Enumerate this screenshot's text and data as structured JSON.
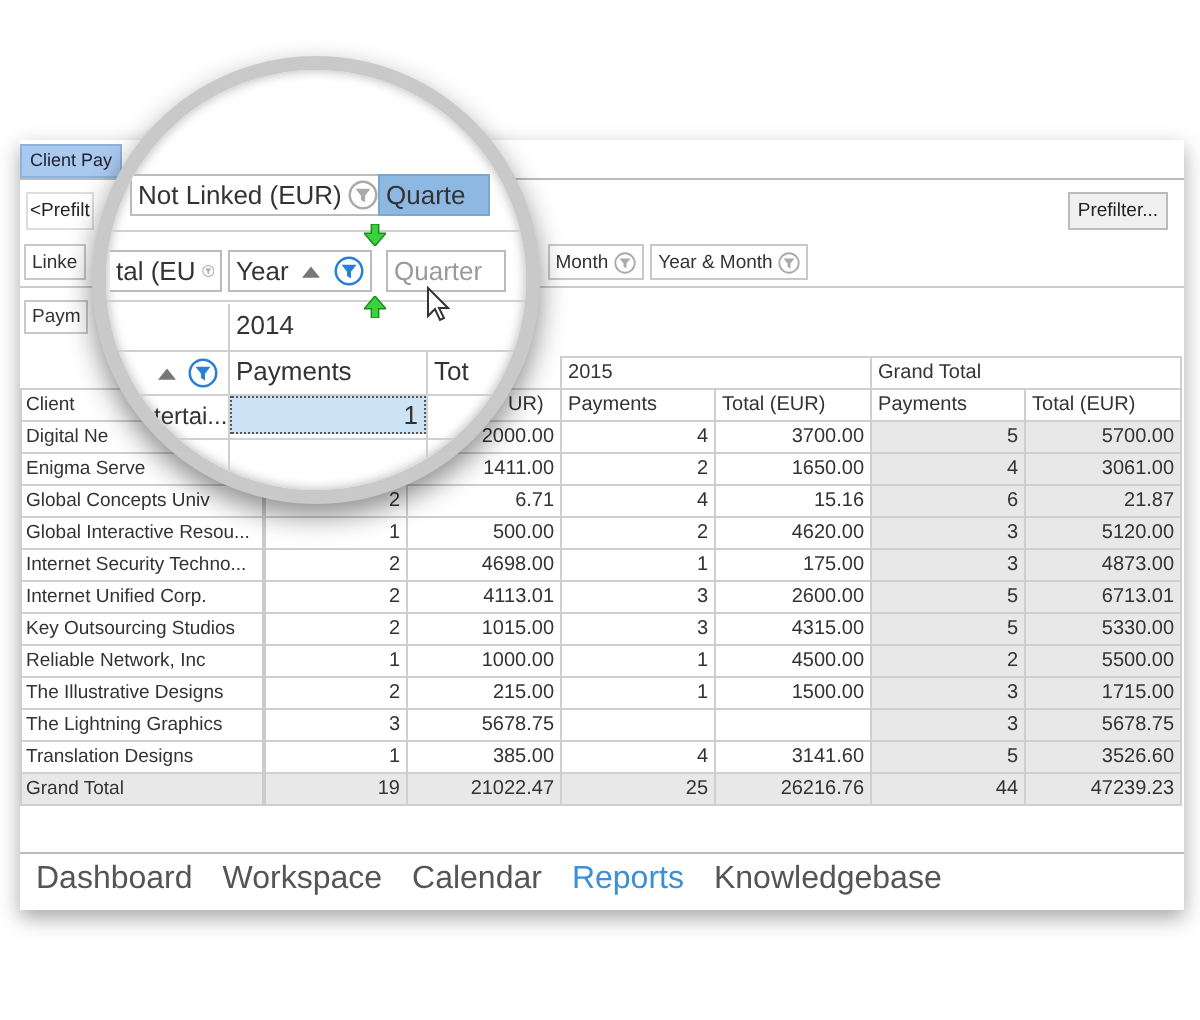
{
  "window_tab": {
    "label": "Client Pay",
    "selected": true
  },
  "toolbar": {
    "prefilter_left": "<Prefilt",
    "prefilter_button": "Prefilter..."
  },
  "column_fields": [
    {
      "label": "Linke"
    },
    {
      "label": "Month",
      "filtered": false
    },
    {
      "label": "Year & Month",
      "filtered": false
    }
  ],
  "data_field": {
    "label": "Paym"
  },
  "magnifier": {
    "data_fields": [
      {
        "label": "Not Linked (EUR)",
        "filtered": false,
        "selected": false
      },
      {
        "label": "Quarte",
        "selected": true
      }
    ],
    "column_fields": [
      {
        "label": "tal (EU",
        "filtered": false,
        "dragged": false
      },
      {
        "label": "Year",
        "filtered": true,
        "sorted": true,
        "dragged": false
      },
      {
        "label": "Quarter",
        "dragged": true
      }
    ],
    "year_header": "2014",
    "client_header_filtered": true,
    "payments_header": "Payments",
    "total_header": "Tot",
    "row_label": "tertai...",
    "selected_cell": "1"
  },
  "table": {
    "year_headers": [
      "2015",
      "Grand Total"
    ],
    "columns": [
      "Client",
      null,
      "UR)",
      "Payments",
      "Total (EUR)",
      "Payments",
      "Total (EUR)"
    ],
    "rows": [
      {
        "kind": "data",
        "cells": [
          "Digital Ne",
          null,
          "2000.00",
          "4",
          "3700.00",
          "5",
          "5700.00"
        ]
      },
      {
        "kind": "data",
        "cells": [
          "Enigma Serve",
          null,
          "1411.00",
          "2",
          "1650.00",
          "4",
          "3061.00"
        ]
      },
      {
        "kind": "data",
        "cells": [
          "Global Concepts Univ",
          "2",
          "6.71",
          "4",
          "15.16",
          "6",
          "21.87"
        ]
      },
      {
        "kind": "data",
        "cells": [
          "Global Interactive Resou...",
          "1",
          "500.00",
          "2",
          "4620.00",
          "3",
          "5120.00"
        ]
      },
      {
        "kind": "data",
        "cells": [
          "Internet Security Techno...",
          "2",
          "4698.00",
          "1",
          "175.00",
          "3",
          "4873.00"
        ]
      },
      {
        "kind": "data",
        "cells": [
          "Internet Unified Corp.",
          "2",
          "4113.01",
          "3",
          "2600.00",
          "5",
          "6713.01"
        ]
      },
      {
        "kind": "data",
        "cells": [
          "Key Outsourcing Studios",
          "2",
          "1015.00",
          "3",
          "4315.00",
          "5",
          "5330.00"
        ]
      },
      {
        "kind": "data",
        "cells": [
          "Reliable Network, Inc",
          "1",
          "1000.00",
          "1",
          "4500.00",
          "2",
          "5500.00"
        ]
      },
      {
        "kind": "data",
        "cells": [
          "The Illustrative Designs",
          "2",
          "215.00",
          "1",
          "1500.00",
          "3",
          "1715.00"
        ]
      },
      {
        "kind": "data",
        "cells": [
          "The Lightning Graphics",
          "3",
          "5678.75",
          null,
          null,
          "3",
          "5678.75"
        ]
      },
      {
        "kind": "data",
        "cells": [
          "Translation Designs",
          "1",
          "385.00",
          "4",
          "3141.60",
          "5",
          "3526.60"
        ]
      },
      {
        "kind": "total",
        "cells": [
          "Grand Total",
          "19",
          "21022.47",
          "25",
          "26216.76",
          "44",
          "47239.23"
        ]
      }
    ]
  },
  "nav": [
    {
      "label": "Dashboard",
      "selected": false
    },
    {
      "label": "Workspace",
      "selected": false
    },
    {
      "label": "Calendar",
      "selected": false
    },
    {
      "label": "Reports",
      "selected": true
    },
    {
      "label": "Knowledgebase",
      "selected": false
    }
  ]
}
